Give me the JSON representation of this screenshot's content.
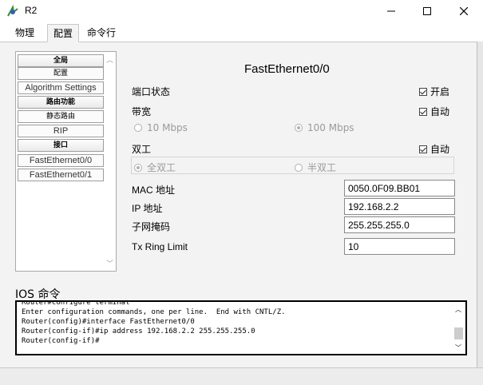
{
  "window": {
    "title": "R2",
    "controls": {
      "minimize": "—",
      "maximize": "☐",
      "close": "✕"
    }
  },
  "tabs": [
    {
      "label": "物理"
    },
    {
      "label": "配置",
      "active": true
    },
    {
      "label": "命令行"
    }
  ],
  "sidebar": {
    "items": [
      {
        "label": "全局",
        "style": "bold"
      },
      {
        "label": "配置",
        "style": "small"
      },
      {
        "label": "Algorithm Settings",
        "style": "normal"
      },
      {
        "label": "路由功能",
        "style": "bold"
      },
      {
        "label": "静态路由",
        "style": "small"
      },
      {
        "label": "RIP",
        "style": "normal"
      },
      {
        "label": "接口",
        "style": "bold"
      },
      {
        "label": "FastEthernet0/0",
        "style": "normal"
      },
      {
        "label": "FastEthernet0/1",
        "style": "normal"
      }
    ]
  },
  "interface": {
    "name": "FastEthernet0/0",
    "port_status": {
      "label": "端口状态",
      "check_label": "开启",
      "checked": true
    },
    "bandwidth": {
      "label": "带宽",
      "check_label": "自动",
      "checked": true,
      "option_10": "10 Mbps",
      "option_100": "100 Mbps",
      "selected": "100 Mbps"
    },
    "duplex": {
      "label": "双工",
      "check_label": "自动",
      "checked": true,
      "option_full": "全双工",
      "option_half": "半双工",
      "selected": "全双工"
    },
    "mac": {
      "label": "MAC 地址",
      "value": "0050.0F09.BB01"
    },
    "ip": {
      "label": "IP 地址",
      "value": "192.168.2.2"
    },
    "mask": {
      "label": "子网掩码",
      "value": "255.255.255.0"
    },
    "tx_ring": {
      "label": "Tx Ring Limit",
      "value": "10"
    }
  },
  "ios": {
    "label": "IOS 命令",
    "lines": [
      "Router#configure terminal",
      "Enter configuration commands, one per line.  End with CNTL/Z.",
      "Router(config)#interface FastEthernet0/0",
      "Router(config-if)#ip address 192.168.2.2 255.255.255.0",
      "Router(config-if)#"
    ]
  },
  "colors": {
    "accent_icon_green": "#3c8a2e",
    "accent_icon_blue": "#2a62b8"
  }
}
